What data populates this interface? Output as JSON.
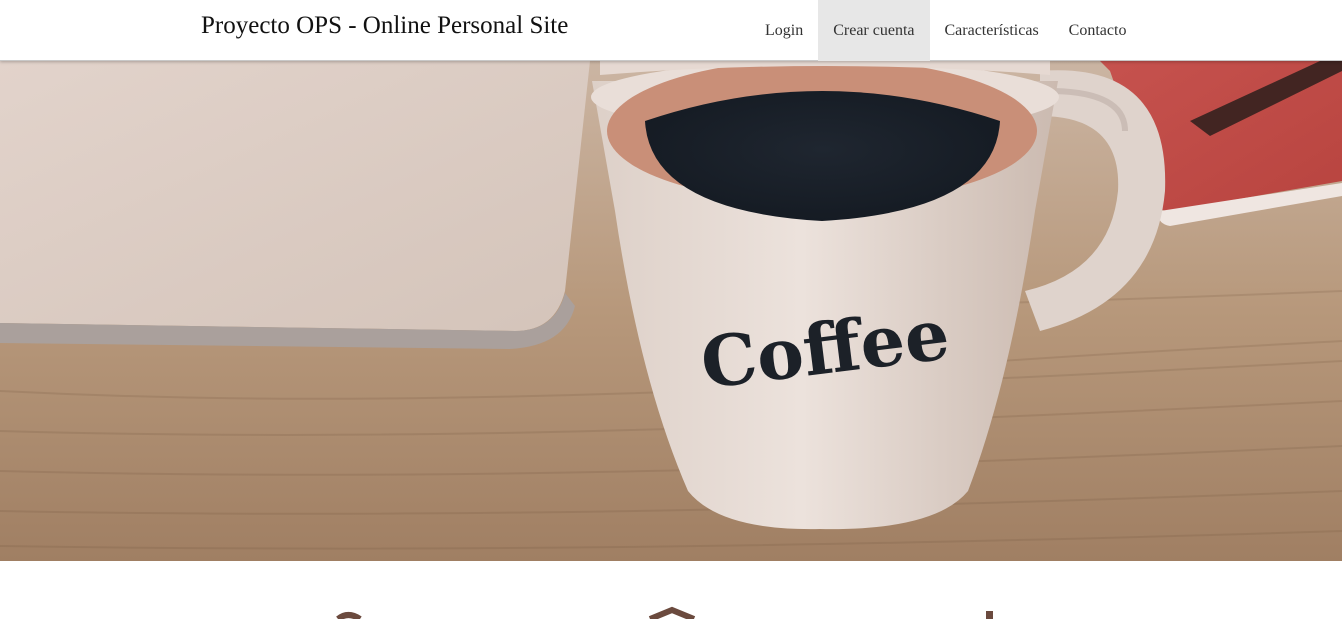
{
  "navbar": {
    "brand": "Proyecto OPS - Online Personal Site",
    "links": [
      {
        "label": "Login",
        "active": false
      },
      {
        "label": "Crear cuenta",
        "active": true
      },
      {
        "label": "Características",
        "active": false
      },
      {
        "label": "Contacto",
        "active": false
      }
    ]
  },
  "hero": {
    "mug_text": "Coffee"
  },
  "colors": {
    "nav_background": "#ffffff",
    "active_link_background": "#e7e7e7",
    "icon_brown": "#6b4a3e"
  }
}
